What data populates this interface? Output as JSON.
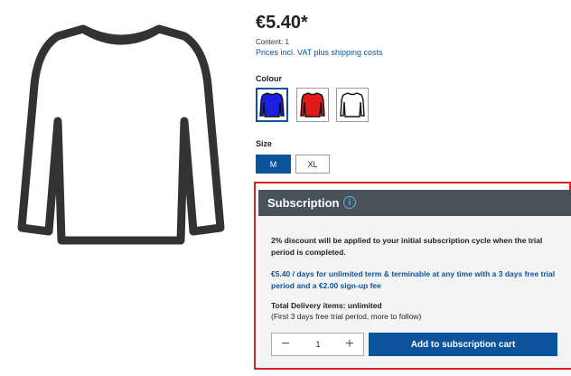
{
  "product": {
    "price": "€5.40*",
    "content": "Content: 1",
    "vat_link": "Prices incl. VAT plus shipping costs"
  },
  "colour": {
    "label": "Colour",
    "options": [
      {
        "name": "blue",
        "color": "#1a1fe0",
        "selected": true
      },
      {
        "name": "red",
        "color": "#e01a1a",
        "selected": false
      },
      {
        "name": "white",
        "color": "#ffffff",
        "selected": false
      }
    ]
  },
  "size": {
    "label": "Size",
    "options": [
      {
        "label": "M",
        "selected": true
      },
      {
        "label": "XL",
        "selected": false
      }
    ]
  },
  "subscription": {
    "title": "Subscription",
    "info_icon": "i",
    "discount_text": "2% discount will be applied to your initial subscription cycle when the trial period is completed.",
    "terms_text": "€5.40 / days for unlimited term & terminable at any time with a 3 days free trial period and a €2.00 sign-up fee",
    "total_text": "Total Delivery items: unlimited",
    "trial_text": "(First 3 days free trial period, more to follow)",
    "quantity": "1",
    "minus": "−",
    "plus": "+",
    "add_button": "Add to subscription cart"
  },
  "colors": {
    "accent": "#0b539b",
    "header": "#4a5258",
    "highlight_border": "#dd2222"
  }
}
